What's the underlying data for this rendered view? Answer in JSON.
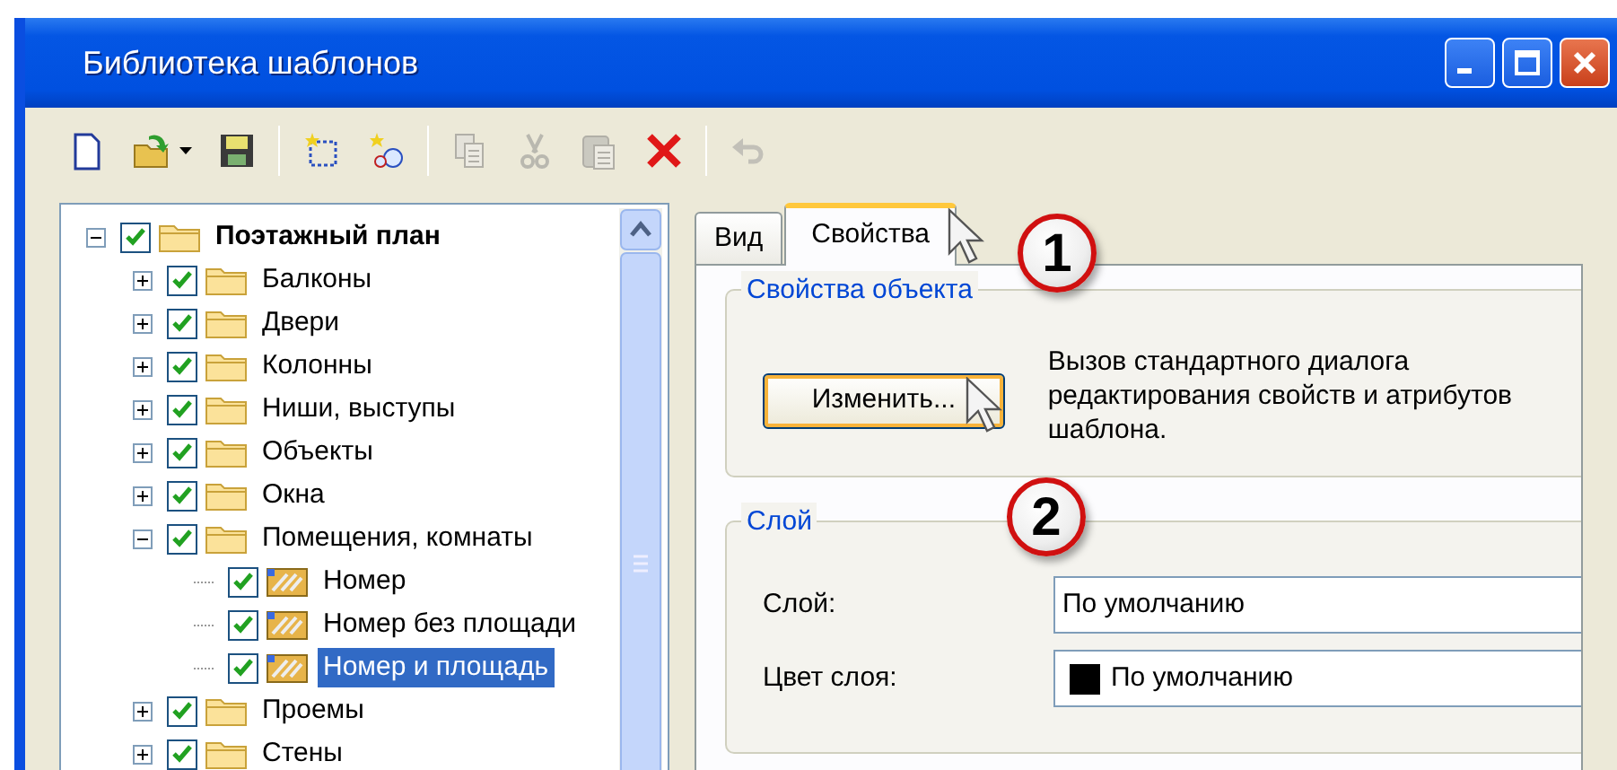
{
  "window": {
    "title": "Библиотека шаблонов",
    "controls": [
      {
        "kind": "minimize"
      },
      {
        "kind": "maximize"
      },
      {
        "kind": "close"
      }
    ]
  },
  "toolbar": [
    {
      "kind": "new",
      "disabled": false
    },
    {
      "kind": "open",
      "disabled": false
    },
    {
      "kind": "save",
      "disabled": false
    },
    {
      "kind": "separator"
    },
    {
      "kind": "new-item",
      "disabled": false
    },
    {
      "kind": "new-group",
      "disabled": false
    },
    {
      "kind": "separator"
    },
    {
      "kind": "copy",
      "disabled": true
    },
    {
      "kind": "cut",
      "disabled": true
    },
    {
      "kind": "paste",
      "disabled": true
    },
    {
      "kind": "delete",
      "disabled": false
    },
    {
      "kind": "separator"
    },
    {
      "kind": "undo",
      "disabled": true
    }
  ],
  "tree": [
    {
      "label": "Поэтажный план",
      "kind": "folder",
      "checked": true,
      "expanded": true,
      "selected": false,
      "children": [
        {
          "label": "Балконы",
          "kind": "folder",
          "checked": true,
          "expanded": false,
          "selected": false
        },
        {
          "label": "Двери",
          "kind": "folder",
          "checked": true,
          "expanded": false,
          "selected": false
        },
        {
          "label": "Колонны",
          "kind": "folder",
          "checked": true,
          "expanded": false,
          "selected": false
        },
        {
          "label": "Ниши, выступы",
          "kind": "folder",
          "checked": true,
          "expanded": false,
          "selected": false
        },
        {
          "label": "Объекты",
          "kind": "folder",
          "checked": true,
          "expanded": false,
          "selected": false
        },
        {
          "label": "Окна",
          "kind": "folder",
          "checked": true,
          "expanded": false,
          "selected": false
        },
        {
          "label": "Помещения, комнаты",
          "kind": "folder",
          "checked": true,
          "expanded": true,
          "selected": false,
          "children": [
            {
              "label": "Номер",
              "kind": "template",
              "checked": true,
              "selected": false
            },
            {
              "label": "Номер без площади",
              "kind": "template",
              "checked": true,
              "selected": false
            },
            {
              "label": "Номер и площадь",
              "kind": "template",
              "checked": true,
              "selected": true
            }
          ]
        },
        {
          "label": "Проемы",
          "kind": "folder",
          "checked": true,
          "expanded": false,
          "selected": false
        },
        {
          "label": "Стены",
          "kind": "folder",
          "checked": true,
          "expanded": false,
          "selected": false
        }
      ]
    }
  ],
  "tabs": [
    {
      "label": "Вид",
      "selected": false
    },
    {
      "label": "Свойства",
      "selected": true
    }
  ],
  "object_properties": {
    "title": "Свойства объекта",
    "button": "Изменить...",
    "description": "Вызов стандартного диалога редактирования свойств и атрибутов шаблона."
  },
  "layer": {
    "title": "Слой",
    "fields": [
      {
        "label": "Слой:",
        "value": "По умолчанию"
      },
      {
        "label": "Цвет слоя:",
        "value": "По умолчанию",
        "color": "#000000"
      }
    ]
  },
  "callouts": [
    "1",
    "2"
  ]
}
